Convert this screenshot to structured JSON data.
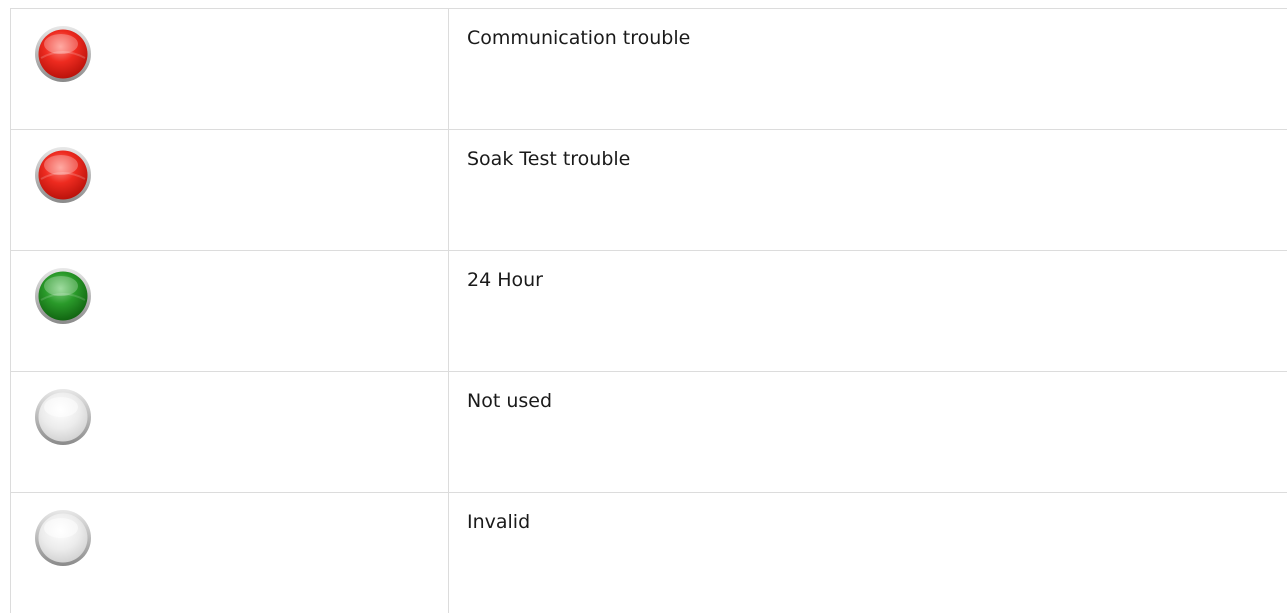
{
  "status_rows": [
    {
      "indicator_icon": "red-indicator-icon",
      "indicator_color": "#e0201a",
      "label": "Communication trouble"
    },
    {
      "indicator_icon": "red-indicator-icon",
      "indicator_color": "#e0201a",
      "label": "Soak Test trouble"
    },
    {
      "indicator_icon": "green-indicator-icon",
      "indicator_color": "#1f8f1f",
      "label": "24 Hour"
    },
    {
      "indicator_icon": "grey-indicator-icon",
      "indicator_color": "#e6e6e6",
      "label": "Not used"
    },
    {
      "indicator_icon": "grey-indicator-icon",
      "indicator_color": "#e6e6e6",
      "label": "Invalid"
    }
  ]
}
